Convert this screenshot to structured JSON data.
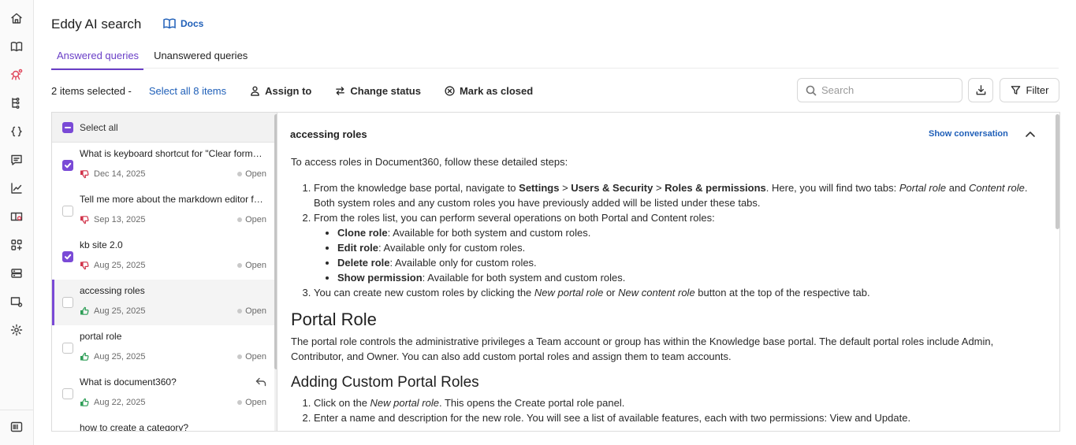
{
  "header": {
    "title": "Eddy AI search",
    "docs_label": "Docs"
  },
  "tabs": [
    {
      "label": "Answered queries",
      "active": true
    },
    {
      "label": "Unanswered queries",
      "active": false
    }
  ],
  "toolbar": {
    "selection_text": "2 items selected -",
    "select_all_link": "Select all 8 items",
    "assign_label": "Assign to",
    "change_status_label": "Change status",
    "mark_closed_label": "Mark as closed"
  },
  "search": {
    "placeholder": "Search"
  },
  "filter": {
    "label": "Filter"
  },
  "list": {
    "select_all_label": "Select all",
    "items": [
      {
        "question": "What is keyboard shortcut for \"Clear formatting\"",
        "date": "Dec 14, 2025",
        "status": "Open",
        "feedback": "dislike",
        "checked": true
      },
      {
        "question": "Tell me more about the markdown editor features",
        "date": "Sep 13, 2025",
        "status": "Open",
        "feedback": "dislike",
        "checked": false
      },
      {
        "question": "kb site 2.0",
        "date": "Aug 25, 2025",
        "status": "Open",
        "feedback": "dislike",
        "checked": true
      },
      {
        "question": "accessing roles",
        "date": "Aug 25, 2025",
        "status": "Open",
        "feedback": "like",
        "checked": false,
        "active": true
      },
      {
        "question": "portal role",
        "date": "Aug 25, 2025",
        "status": "Open",
        "feedback": "like",
        "checked": false
      },
      {
        "question": "What is document360?",
        "date": "Aug 22, 2025",
        "status": "Open",
        "feedback": "like",
        "checked": false,
        "replied": true
      },
      {
        "question": "how to create a category?",
        "date": "",
        "status": "",
        "feedback": "",
        "checked": false
      }
    ]
  },
  "detail": {
    "title": "accessing roles",
    "show_conversation": "Show conversation",
    "intro": "To access roles in Document360, follow these detailed steps:",
    "step1": {
      "a": "From the knowledge base portal, navigate to ",
      "b": "Settings",
      "c": " > ",
      "d": "Users & Security",
      "e": " > ",
      "f": "Roles & permissions",
      "g": ". Here, you will find two tabs: ",
      "h": "Portal role",
      "i": " and ",
      "j": "Content role",
      "k": ". Both system roles and any custom roles you have previously added will be listed under these tabs."
    },
    "step2": {
      "text": "From the roles list, you can perform several operations on both Portal and Content roles:",
      "bullets": [
        {
          "b": "Clone role",
          "t": ": Available for both system and custom roles."
        },
        {
          "b": "Edit role",
          "t": ": Available only for custom roles."
        },
        {
          "b": "Delete role",
          "t": ": Available only for custom roles."
        },
        {
          "b": "Show permission",
          "t": ": Available for both system and custom roles."
        }
      ]
    },
    "step3": {
      "a": "You can create new custom roles by clicking the ",
      "b": "New portal role",
      "c": " or ",
      "d": "New content role",
      "e": " button at the top of the respective tab."
    },
    "h_portal": "Portal Role",
    "portal_para": "The portal role controls the administrative privileges a Team account or group has within the Knowledge base portal. The default portal roles include Admin, Contributor, and Owner. You can also add custom portal roles and assign them to team accounts.",
    "h_adding": "Adding Custom Portal Roles",
    "add_step1": {
      "a": "Click on the ",
      "b": "New portal role",
      "c": ". This opens the Create portal role panel."
    },
    "add_step2": "Enter a name and description for the new role. You will see a list of available features, each with two permissions: View and Update."
  }
}
